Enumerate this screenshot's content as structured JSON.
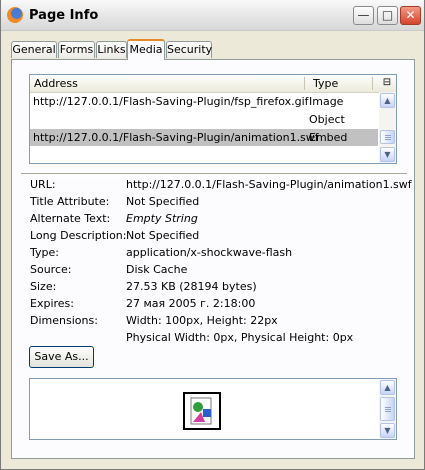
{
  "window": {
    "title": "Page Info",
    "min_glyph": "—",
    "max_glyph": "□",
    "close_glyph": "✕"
  },
  "tabs": [
    {
      "label": "General"
    },
    {
      "label": "Forms"
    },
    {
      "label": "Links"
    },
    {
      "label": "Media",
      "active": true
    },
    {
      "label": "Security"
    }
  ],
  "media_list": {
    "columns": {
      "address": "Address",
      "type": "Type"
    },
    "column_picker_glyph": "⊟",
    "rows": [
      {
        "address": "http://127.0.0.1/Flash-Saving-Plugin/fsp_firefox.gif",
        "type": "Image"
      },
      {
        "address": "",
        "type": "Object"
      },
      {
        "address": "http://127.0.0.1/Flash-Saving-Plugin/animation1.swf",
        "type": "Embed",
        "selected": true
      }
    ],
    "scroll_up_glyph": "▲",
    "scroll_down_glyph": "▼"
  },
  "properties": [
    {
      "label": "URL:",
      "value": "http://127.0.0.1/Flash-Saving-Plugin/animation1.swf"
    },
    {
      "label": "Title Attribute:",
      "value": "Not Specified"
    },
    {
      "label": "Alternate Text:",
      "value": "Empty String",
      "italic": true
    },
    {
      "label": "Long Description:",
      "value": "Not Specified"
    },
    {
      "label": "Type:",
      "value": "application/x-shockwave-flash"
    },
    {
      "label": "Source:",
      "value": "Disk Cache"
    },
    {
      "label": "Size:",
      "value": "27.53 KB (28194 bytes)"
    },
    {
      "label": "Expires:",
      "value": "27 мая 2005 г. 2:18:00"
    },
    {
      "label": "Dimensions:",
      "value": "Width: 100px, Height: 22px"
    },
    {
      "label": "",
      "value": "Physical Width: 0px, Physical Height: 0px"
    }
  ],
  "save_button": {
    "label": "Save As..."
  },
  "preview": {
    "icon": "missing-plugin-icon"
  },
  "colors": {
    "tab_accent": "#e68b2c",
    "selection": "#c1c1c1",
    "list_border": "#7f9db9"
  }
}
